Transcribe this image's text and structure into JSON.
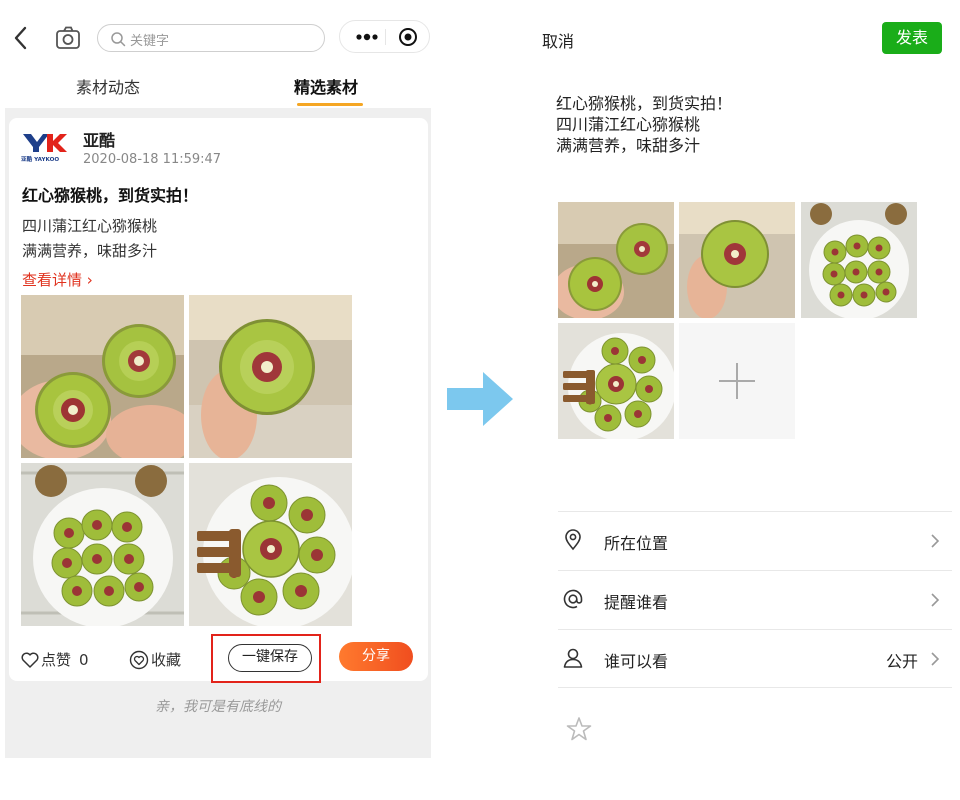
{
  "left": {
    "search_placeholder": "关键字",
    "tabs": [
      {
        "label": "素材动态",
        "active": false
      },
      {
        "label": "精选素材",
        "active": true
      }
    ],
    "post": {
      "author": "亚酷",
      "logo_text": "亚酷 YAYKOO",
      "date": "2020-08-18 11:59:47",
      "title": "红心猕猴桃，到货实拍！",
      "line1": "四川蒲江红心猕猴桃",
      "line2": "满满营养，味甜多汁",
      "detail_link": "查看详情 ›",
      "like_label": "点赞",
      "like_count": "0",
      "fav_label": "收藏",
      "save_label": "一键保存",
      "share_label": "分享"
    },
    "bottom_note": "亲，我可是有底线的"
  },
  "right": {
    "cancel_label": "取消",
    "publish_label": "发表",
    "text_lines": [
      "红心猕猴桃，到货实拍！",
      "四川蒲江红心猕猴桃",
      "满满营养，味甜多汁"
    ],
    "rows": [
      {
        "icon": "location-pin-icon",
        "label": "所在位置",
        "value": ""
      },
      {
        "icon": "at-icon",
        "label": "提醒谁看",
        "value": ""
      },
      {
        "icon": "person-icon",
        "label": "谁可以看",
        "value": "公开"
      }
    ]
  },
  "colors": {
    "accent_orange": "#f5a623",
    "share_gradient": "#f04e1f",
    "publish_green": "#1aad19",
    "highlight_red": "#e2231a",
    "link_red": "#e0321e",
    "arrow_blue": "#7cc8ee"
  }
}
